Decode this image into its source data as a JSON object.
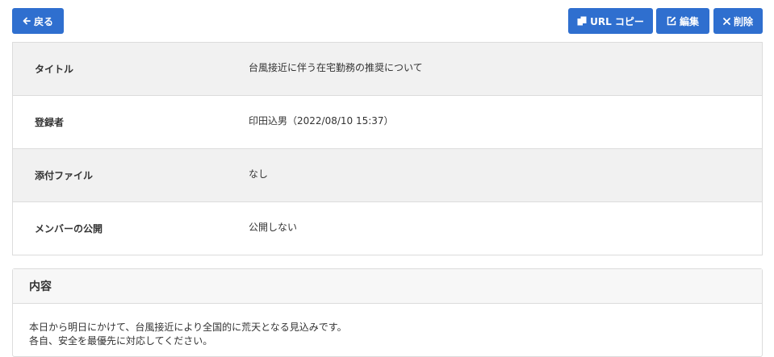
{
  "toolbar": {
    "back_label": "戻る",
    "url_copy_label": "URL コピー",
    "edit_label": "編集",
    "delete_label": "削除"
  },
  "details": {
    "rows": [
      {
        "label": "タイトル",
        "value": "台風接近に伴う在宅勤務の推奨について"
      },
      {
        "label": "登録者",
        "value": "印田込男（2022/08/10 15:37）"
      },
      {
        "label": "添付ファイル",
        "value": "なし"
      },
      {
        "label": "メンバーの公開",
        "value": "公開しない"
      }
    ]
  },
  "content": {
    "heading": "内容",
    "lines": [
      "本日から明日にかけて、台風接近により全国的に荒天となる見込みです。",
      "各自、安全を最優先に対応してください。"
    ]
  },
  "colors": {
    "accent": "#2f6fcf",
    "row_shade": "#f1f1f1",
    "border": "#dcdcdc"
  },
  "icons": [
    "arrow-left-icon",
    "copy-icon",
    "edit-icon",
    "close-icon"
  ]
}
